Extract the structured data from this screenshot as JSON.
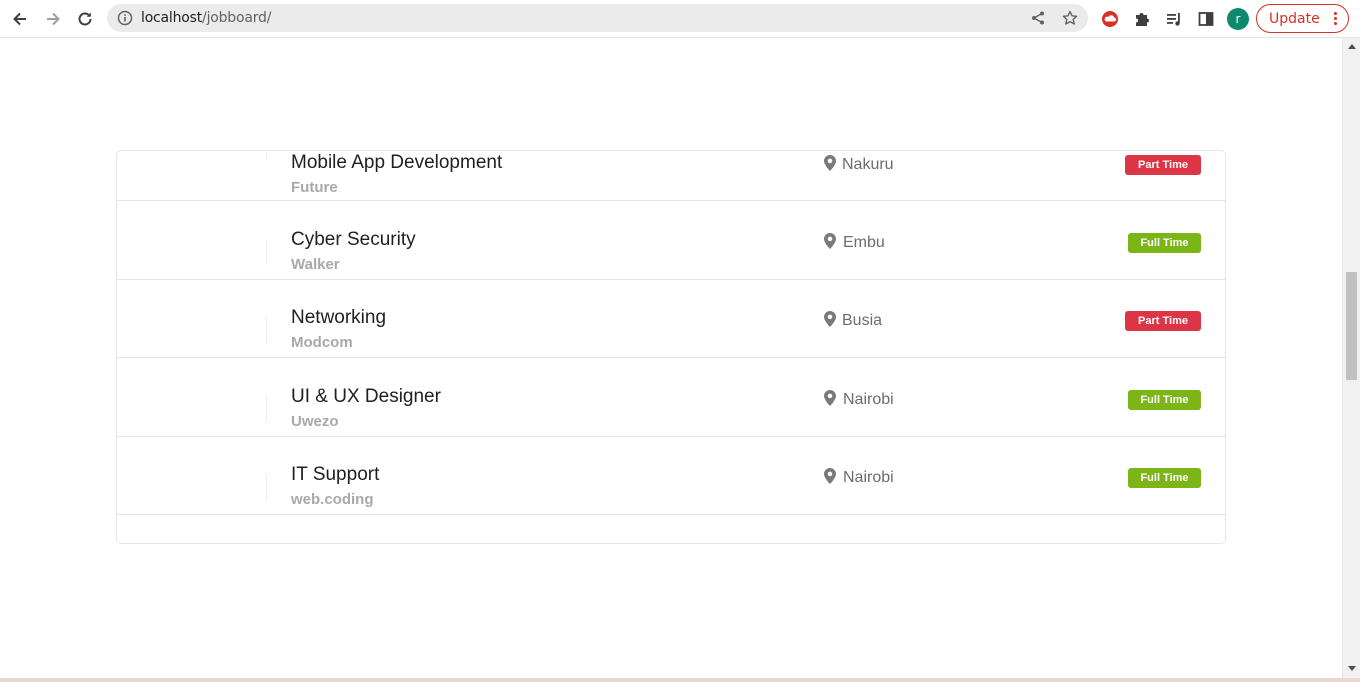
{
  "browser": {
    "url_host": "localhost",
    "url_path": "/jobboard/",
    "profile_initial": "r",
    "update_label": "Update"
  },
  "jobs": [
    {
      "title": "Mobile App Development",
      "company": "Future",
      "location": "Nakuru",
      "type": "Part Time",
      "type_color": "#dc3545"
    },
    {
      "title": "Cyber Security",
      "company": "Walker",
      "location": "Embu",
      "type": "Full Time",
      "type_color": "#7cb518"
    },
    {
      "title": "Networking",
      "company": "Modcom",
      "location": "Busia",
      "type": "Part Time",
      "type_color": "#dc3545"
    },
    {
      "title": "UI & UX Designer",
      "company": "Uwezo",
      "location": "Nairobi",
      "type": "Full Time",
      "type_color": "#7cb518"
    },
    {
      "title": "IT Support",
      "company": "web.coding",
      "location": "Nairobi",
      "type": "Full Time",
      "type_color": "#7cb518"
    }
  ],
  "icons": {
    "back": "arrow-left-icon",
    "forward": "arrow-right-icon",
    "reload": "reload-icon",
    "info": "info-icon",
    "share": "share-icon",
    "bookmark": "star-icon",
    "extension1": "cloud-extension-icon",
    "extensions": "puzzle-icon",
    "media": "media-playlist-icon",
    "sidepanel": "side-panel-icon",
    "location": "map-pin-icon"
  }
}
